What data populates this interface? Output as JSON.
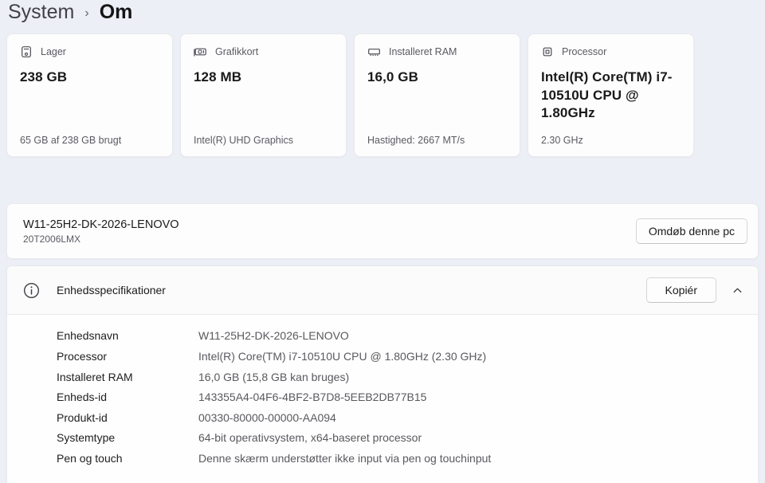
{
  "breadcrumb": {
    "root": "System",
    "separator": "›",
    "current": "Om"
  },
  "cards": [
    {
      "icon": "storage-icon",
      "label": "Lager",
      "value": "238 GB",
      "caption": "65 GB af 238 GB brugt"
    },
    {
      "icon": "gpu-icon",
      "label": "Grafikkort",
      "value": "128 MB",
      "caption": "Intel(R) UHD Graphics"
    },
    {
      "icon": "ram-icon",
      "label": "Installeret RAM",
      "value": "16,0 GB",
      "caption": "Hastighed: 2667 MT/s"
    },
    {
      "icon": "cpu-icon",
      "label": "Processor",
      "value": "Intel(R) Core(TM) i7-10510U CPU @ 1.80GHz",
      "caption": "2.30 GHz"
    }
  ],
  "device": {
    "name": "W11-25H2-DK-2026-LENOVO",
    "model": "20T2006LMX",
    "rename_button": "Omdøb denne pc"
  },
  "specs": {
    "title": "Enhedsspecifikationer",
    "copy_button": "Kopiér",
    "rows": [
      {
        "label": "Enhedsnavn",
        "value": "W11-25H2-DK-2026-LENOVO"
      },
      {
        "label": "Processor",
        "value": "Intel(R) Core(TM) i7-10510U CPU @ 1.80GHz (2.30 GHz)"
      },
      {
        "label": "Installeret RAM",
        "value": "16,0 GB (15,8 GB kan bruges)"
      },
      {
        "label": "Enheds-id",
        "value": "143355A4-04F6-4BF2-B7D8-5EEB2DB77B15"
      },
      {
        "label": "Produkt-id",
        "value": "00330-80000-00000-AA094"
      },
      {
        "label": "Systemtype",
        "value": "64-bit operativsystem, x64-baseret processor"
      },
      {
        "label": "Pen og touch",
        "value": "Denne skærm understøtter ikke input via pen og touchinput"
      }
    ]
  },
  "colors": {
    "page_background": "#edeff6",
    "card_background": "#fdfdfe",
    "card_border": "#e9e9ed",
    "text_primary": "#1b1b1b",
    "text_secondary": "#5a5a61"
  }
}
